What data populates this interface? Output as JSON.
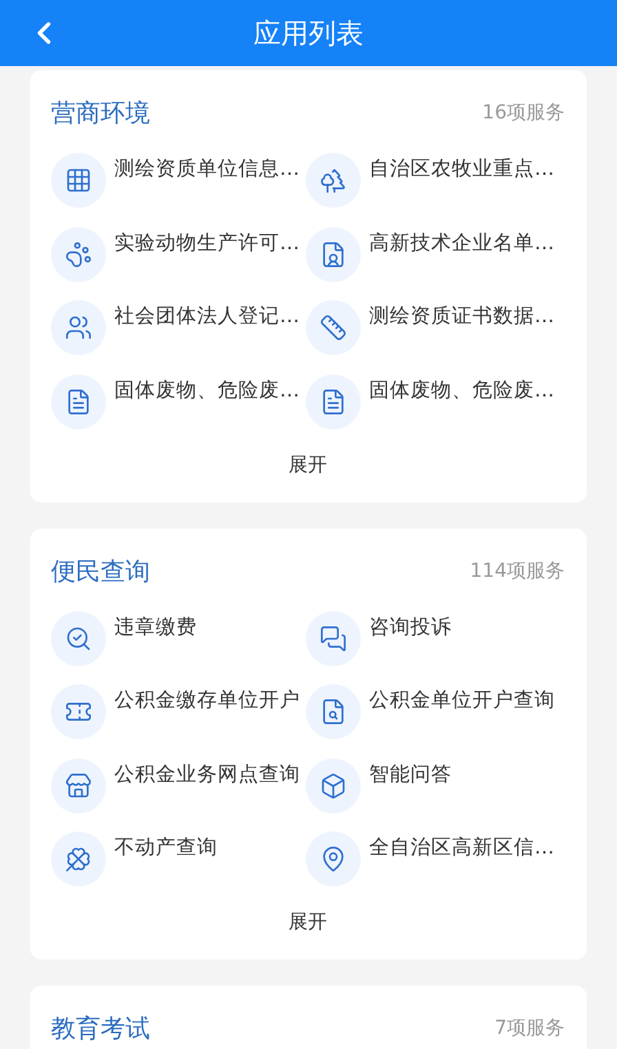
{
  "header": {
    "title": "应用列表"
  },
  "sections": [
    {
      "title": "营商环境",
      "count": "16项服务",
      "expand": "展开",
      "items": [
        {
          "label": "测绘资质单位信息…"
        },
        {
          "label": "自治区农牧业重点…"
        },
        {
          "label": "实验动物生产许可…"
        },
        {
          "label": "高新技术企业名单…"
        },
        {
          "label": "社会团体法人登记…"
        },
        {
          "label": "测绘资质证书数据…"
        },
        {
          "label": "固体废物、危险废…"
        },
        {
          "label": "固体废物、危险废…"
        }
      ]
    },
    {
      "title": "便民查询",
      "count": "114项服务",
      "expand": "展开",
      "items": [
        {
          "label": "违章缴费"
        },
        {
          "label": "咨询投诉"
        },
        {
          "label": "公积金缴存单位开户"
        },
        {
          "label": "公积金单位开户查询"
        },
        {
          "label": "公积金业务网点查询"
        },
        {
          "label": "智能问答"
        },
        {
          "label": "不动产查询"
        },
        {
          "label": "全自治区高新区信…"
        }
      ]
    },
    {
      "title": "教育考试",
      "count": "7项服务"
    }
  ]
}
